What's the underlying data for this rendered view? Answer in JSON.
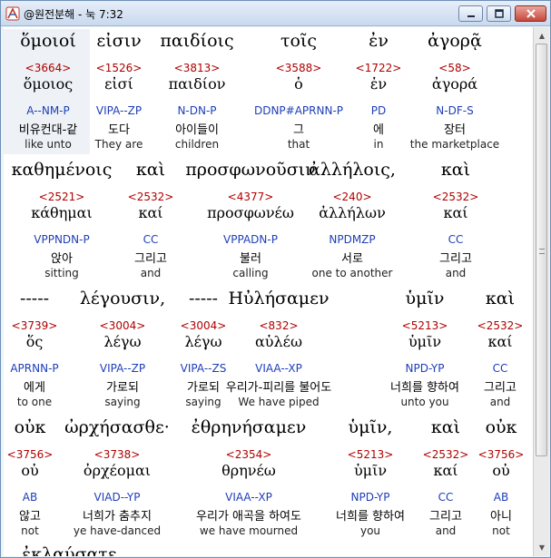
{
  "window": {
    "title": "@원전분해 - 눅 7:32"
  },
  "rows": [
    {
      "words": [
        {
          "greek": "ὅμοιοί",
          "strong": "<3664>",
          "lemma": "ὅμοιος",
          "parse": "A--NM-P",
          "korean": "비유컨대-같",
          "english": "like unto"
        },
        {
          "greek": "εἰσιν",
          "strong": "<1526>",
          "lemma": "εἰσί",
          "parse": "VIPA--ZP",
          "korean": "도다",
          "english": "They are"
        },
        {
          "greek": "παιδίοις",
          "strong": "<3813>",
          "lemma": "παιδίον",
          "parse": "N-DN-P",
          "korean": "아이들이",
          "english": "children"
        },
        {
          "greek": "τοῖς",
          "strong": "<3588>",
          "lemma": "ὁ",
          "parse": "DDNP#APRNN-P",
          "korean": "그",
          "english": "that"
        },
        {
          "greek": "ἐν",
          "strong": "<1722>",
          "lemma": "ἐν",
          "parse": "PD",
          "korean": "에",
          "english": "in"
        },
        {
          "greek": "ἀγορᾷ",
          "strong": "<58>",
          "lemma": "ἀγορά",
          "parse": "N-DF-S",
          "korean": "장터",
          "english": "the marketplace"
        }
      ]
    },
    {
      "words": [
        {
          "greek": "καθημένοις",
          "strong": "<2521>",
          "lemma": "κάθημαι",
          "parse": "VPPNDN-P",
          "korean": "앉아",
          "english": "sitting"
        },
        {
          "greek": "καὶ",
          "strong": "<2532>",
          "lemma": "καί",
          "parse": "CC",
          "korean": "그리고",
          "english": "and"
        },
        {
          "greek": "προσφωνοῦσιν",
          "strong": "<4377>",
          "lemma": "προσφωνέω",
          "parse": "VPPADN-P",
          "korean": "불러",
          "english": "calling"
        },
        {
          "greek": "ἀλλήλοις,",
          "strong": "<240>",
          "lemma": "ἀλλήλων",
          "parse": "NPDMZP",
          "korean": "서로",
          "english": "one to another"
        },
        {
          "greek": "καὶ",
          "strong": "<2532>",
          "lemma": "καί",
          "parse": "CC",
          "korean": "그리고",
          "english": "and"
        }
      ]
    },
    {
      "words": [
        {
          "greek": "-----",
          "strong": "<3739>",
          "lemma": "ὅς",
          "parse": "APRNN-P",
          "korean": "에게",
          "english": "to one"
        },
        {
          "greek": "λέγουσιν,",
          "strong": "<3004>",
          "lemma": "λέγω",
          "parse": "VIPA--ZP",
          "korean": "가로되",
          "english": "saying"
        },
        {
          "greek": "-----",
          "strong": "<3004>",
          "lemma": "λέγω",
          "parse": "VIPA--ZS",
          "korean": "가로되",
          "english": "saying"
        },
        {
          "greek": "Ηὐλήσαμεν",
          "strong": "<832>",
          "lemma": "αὐλέω",
          "parse": "VIAA--XP",
          "korean": "우리가-피리를 불어도",
          "english": "We have piped"
        },
        {
          "greek": "ὑμῖν",
          "strong": "<5213>",
          "lemma": "ὑμῖν",
          "parse": "NPD-YP",
          "korean": "너희를 향하여",
          "english": "unto you"
        },
        {
          "greek": "καὶ",
          "strong": "<2532>",
          "lemma": "καί",
          "parse": "CC",
          "korean": "그리고",
          "english": "and"
        }
      ]
    },
    {
      "words": [
        {
          "greek": "οὐκ",
          "strong": "<3756>",
          "lemma": "οὐ",
          "parse": "AB",
          "korean": "않고",
          "english": "not"
        },
        {
          "greek": "ὠρχήσασθε·",
          "strong": "<3738>",
          "lemma": "ὀρχέομαι",
          "parse": "VIAD--YP",
          "korean": "너희가 춤추지",
          "english": "ye have-danced"
        },
        {
          "greek": "ἐθρηνήσαμεν",
          "strong": "<2354>",
          "lemma": "θρηνέω",
          "parse": "VIAA--XP",
          "korean": "우리가 애곡을 하여도",
          "english": "we have mourned"
        },
        {
          "greek": "ὑμῖν,",
          "strong": "<5213>",
          "lemma": "ὑμῖν",
          "parse": "NPD-YP",
          "korean": "너희를 향하여",
          "english": "you"
        },
        {
          "greek": "καὶ",
          "strong": "<2532>",
          "lemma": "καί",
          "parse": "CC",
          "korean": "그리고",
          "english": "and"
        },
        {
          "greek": "οὐκ",
          "strong": "<3756>",
          "lemma": "οὐ",
          "parse": "AB",
          "korean": "아니",
          "english": "not"
        }
      ]
    }
  ],
  "partial_line": "ἐκλαύσατε."
}
